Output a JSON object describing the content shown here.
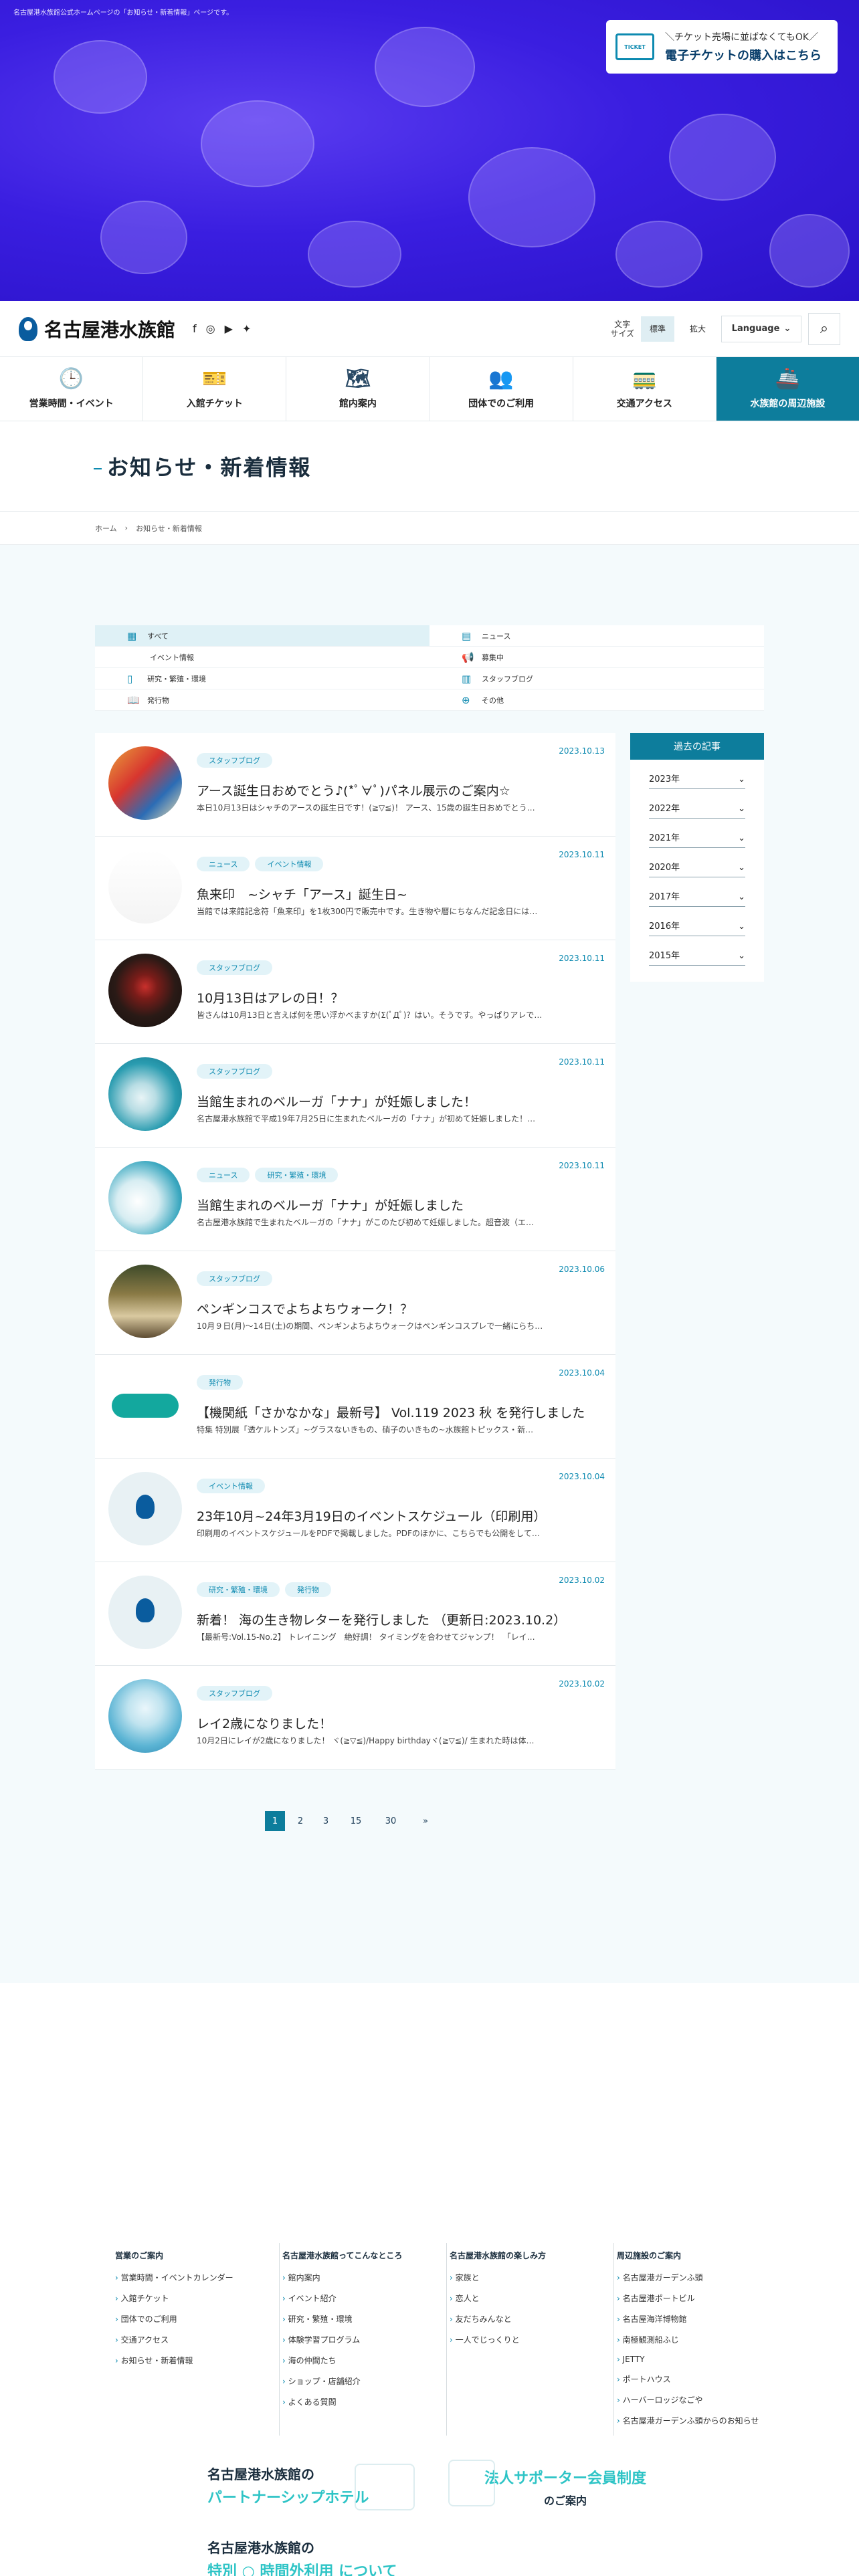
{
  "hero": {
    "caption": "名古屋港水族館公式ホームページの「お知らせ・新着情報」ページです。",
    "ticket_icon": "TICKET",
    "ticket_line1": "＼チケット売場に並ばなくてもOK／",
    "ticket_line2": "電子チケットの購入はこちら"
  },
  "header": {
    "logo": "名古屋港水族館",
    "fontsize_label": "文字\nサイズ",
    "fontsize_standard": "標準",
    "fontsize_large": "拡大",
    "language": "Language",
    "sns_icons": [
      "facebook-icon",
      "instagram-icon",
      "youtube-icon",
      "twitter-icon"
    ]
  },
  "gnav": [
    {
      "label": "営業時間・イベント",
      "icon": "clock-icon",
      "glyph": "🕒"
    },
    {
      "label": "入館チケット",
      "icon": "ticket-icon",
      "glyph": "🎫"
    },
    {
      "label": "館内案内",
      "icon": "map-icon",
      "glyph": "🗺"
    },
    {
      "label": "団体でのご利用",
      "icon": "group-icon",
      "glyph": "👥"
    },
    {
      "label": "交通アクセス",
      "icon": "train-icon",
      "glyph": "🚃"
    },
    {
      "label": "水族館の周辺施設",
      "icon": "ship-icon",
      "glyph": "🚢"
    }
  ],
  "page": {
    "title": "お知らせ・新着情報",
    "breadcrumb_home": "ホーム",
    "breadcrumb_current": "お知らせ・新着情報"
  },
  "filters": [
    [
      {
        "label": "すべて",
        "icon": "grid-icon",
        "glyph": "▦",
        "active": true
      },
      {
        "label": "ニュース",
        "icon": "doc-icon",
        "glyph": "▤"
      }
    ],
    [
      {
        "label": "イベント情報",
        "icon": "",
        "glyph": ""
      },
      {
        "label": "募集中",
        "icon": "megaphone-icon",
        "glyph": "📢"
      }
    ],
    [
      {
        "label": "研究・繁殖・環境",
        "icon": "phone-icon",
        "glyph": "▯"
      },
      {
        "label": "スタッフブログ",
        "icon": "building-icon",
        "glyph": "▥"
      }
    ],
    [
      {
        "label": "発行物",
        "icon": "book-icon",
        "glyph": "📖"
      },
      {
        "label": "その他",
        "icon": "globe-icon",
        "glyph": "⊕"
      }
    ]
  ],
  "articles": [
    {
      "date": "2023.10.13",
      "tags": [
        "スタッフブログ"
      ],
      "title": "アース誕生日おめでとう♪(*ﾟ∀ﾟ)パネル展示のご案内☆",
      "desc": "本日10月13日はシャチのアースの誕生日です！(≧▽≦)！ アース、15歳の誕生日おめでとう…",
      "thumb": "linear-gradient(135deg,#e9a23b 0%,#d8352f 40%,#2b6cb5 70%,#f2e3b0 100%)"
    },
    {
      "date": "2023.10.11",
      "tags": [
        "ニュース",
        "イベント情報"
      ],
      "title": "魚来印　~シャチ「アース」誕生日~",
      "desc": "当館では来館記念符「魚来印」を1枚300円で販売中です。生き物や暦にちなんだ記念日には…",
      "thumb": "linear-gradient(180deg,#ffffff 0%,#f4f4f4 100%)"
    },
    {
      "date": "2023.10.11",
      "tags": [
        "スタッフブログ"
      ],
      "title": "10月13日はアレの日！？",
      "desc": "皆さんは10月13日と言えば何を思い浮かべますか(Σ(ﾟДﾟ)？はい。そうです。やっぱりアレで…",
      "thumb": "radial-gradient(circle at 50% 45%,#c9302c 0%,#7a1c19 22%,#2a1a16 55%,#12100e 100%)"
    },
    {
      "date": "2023.10.11",
      "tags": [
        "スタッフブログ"
      ],
      "title": "当館生まれのベルーガ「ナナ」が妊娠しました！",
      "desc": "名古屋港水族館で平成19年7月25日に生まれたベルーガの「ナナ」が初めて妊娠しました！…",
      "thumb": "radial-gradient(circle at 45% 55%,#e8f4f6 0%,#b8dde4 25%,#2a9cb0 60%,#0d6e84 100%)"
    },
    {
      "date": "2023.10.11",
      "tags": [
        "ニュース",
        "研究・繁殖・環境"
      ],
      "title": "当館生まれのベルーガ「ナナ」が妊娠しました",
      "desc": "名古屋港水族館で生まれたベルーガの「ナナ」がこのたび初めて妊娠しました。超音波（エ…",
      "thumb": "radial-gradient(circle at 40% 55%,#ffffff 0%,#d7edf2 35%,#3ba8c0 70%,#116f8a 100%)"
    },
    {
      "date": "2023.10.06",
      "tags": [
        "スタッフブログ"
      ],
      "title": "ペンギンコスでよちよちウォーク！？",
      "desc": "10月９日(月)～14日(土)の期間、ペンギンよちよちウォークはペンギンコスプレで一緒にらち…",
      "thumb": "linear-gradient(180deg,#3d4a2a 0%,#8a7a45 40%,#d9c9a0 70%,#5c4a30 100%)"
    },
    {
      "date": "2023.10.04",
      "tags": [
        "発行物"
      ],
      "title": "【機関紙「さかなかな」最新号】 Vol.119 2023 秋 を発行しました",
      "desc": "特集 特別展「透ケルトンズ」~グラスないきもの、硝子のいきもの~水族館トピックス・新…",
      "thumb": "logo-sakana"
    },
    {
      "date": "2023.10.04",
      "tags": [
        "イベント情報"
      ],
      "title": "23年10月~24年3月19日のイベントスケジュール（印刷用）",
      "desc": "印刷用のイベントスケジュールをPDFで掲載しました。PDFのほかに、こちらでも公開をして…",
      "thumb": "logo"
    },
    {
      "date": "2023.10.02",
      "tags": [
        "研究・繁殖・環境",
        "発行物"
      ],
      "title": "新着！ 海の生き物レターを発行しました （更新日:2023.10.2）",
      "desc": "【最新号:Vol.15-No.2】 トレイニング　絶好調！ タイミングを合わせてジャンプ！　「レイ…",
      "thumb": "logo"
    },
    {
      "date": "2023.10.02",
      "tags": [
        "スタッフブログ"
      ],
      "title": "レイ2歳になりました！",
      "desc": "10月2日にレイが2歳になりました！ ヾ(≧▽≦)/Happy birthdayヾ(≧▽≦)/ 生まれた時は体…",
      "thumb": "radial-gradient(circle at 50% 40%,#eaf6fb 0%,#bfe3ef 30%,#5bb4d4 65%,#2b86b0 100%)"
    }
  ],
  "sidebar": {
    "title": "過去の記事",
    "years": [
      "2023年",
      "2022年",
      "2021年",
      "2020年",
      "2017年",
      "2016年",
      "2015年"
    ]
  },
  "pager": [
    "1",
    "2",
    "3",
    "15",
    "30",
    "»"
  ],
  "footer": {
    "columns": [
      {
        "head": "営業のご案内",
        "items": [
          "営業時間・イベントカレンダー",
          "入館チケット",
          "団体でのご利用",
          "交通アクセス",
          "お知らせ・新着情報"
        ]
      },
      {
        "head": "名古屋港水族館ってこんなところ",
        "items": [
          "館内案内",
          "イベント紹介",
          "研究・繁殖・環境",
          "体験学習プログラム",
          "海の仲間たち",
          "ショップ・店舗紹介",
          "よくある質問"
        ]
      },
      {
        "head": "名古屋港水族館の楽しみ方",
        "items": [
          "家族と",
          "恋人と",
          "友だちみんなと",
          "一人でじっくりと"
        ]
      },
      {
        "head": "周辺施設のご案内",
        "items": [
          "名古屋港ガーデンふ頭",
          "名古屋港ポートビル",
          "名古屋海洋博物館",
          "南極観測船ふじ",
          "JETTY",
          "ポートハウス",
          "ハーバーロッジなごや",
          "名古屋港ガーデンふ頭からのお知らせ"
        ]
      }
    ],
    "banner1_line1": "名古屋港水族館の",
    "banner1_line2": "パートナーシップホテル",
    "banner2_line1": "法人サポーター会員制度",
    "banner2_line2": "のご案内",
    "banner3_line1": "名古屋港水族館の",
    "banner3_line2": "特別 ○ 時間外利用 について"
  }
}
